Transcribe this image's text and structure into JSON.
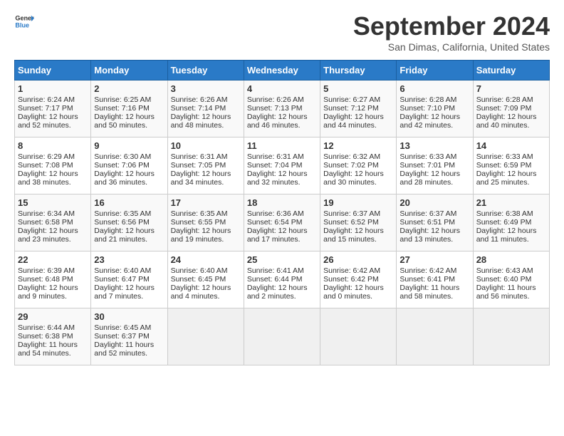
{
  "header": {
    "logo_general": "General",
    "logo_blue": "Blue",
    "title": "September 2024",
    "subtitle": "San Dimas, California, United States"
  },
  "days_of_week": [
    "Sunday",
    "Monday",
    "Tuesday",
    "Wednesday",
    "Thursday",
    "Friday",
    "Saturday"
  ],
  "weeks": [
    [
      {
        "day": "1",
        "sunrise": "6:24 AM",
        "sunset": "7:17 PM",
        "daylight": "12 hours and 52 minutes."
      },
      {
        "day": "2",
        "sunrise": "6:25 AM",
        "sunset": "7:16 PM",
        "daylight": "12 hours and 50 minutes."
      },
      {
        "day": "3",
        "sunrise": "6:26 AM",
        "sunset": "7:14 PM",
        "daylight": "12 hours and 48 minutes."
      },
      {
        "day": "4",
        "sunrise": "6:26 AM",
        "sunset": "7:13 PM",
        "daylight": "12 hours and 46 minutes."
      },
      {
        "day": "5",
        "sunrise": "6:27 AM",
        "sunset": "7:12 PM",
        "daylight": "12 hours and 44 minutes."
      },
      {
        "day": "6",
        "sunrise": "6:28 AM",
        "sunset": "7:10 PM",
        "daylight": "12 hours and 42 minutes."
      },
      {
        "day": "7",
        "sunrise": "6:28 AM",
        "sunset": "7:09 PM",
        "daylight": "12 hours and 40 minutes."
      }
    ],
    [
      {
        "day": "8",
        "sunrise": "6:29 AM",
        "sunset": "7:08 PM",
        "daylight": "12 hours and 38 minutes."
      },
      {
        "day": "9",
        "sunrise": "6:30 AM",
        "sunset": "7:06 PM",
        "daylight": "12 hours and 36 minutes."
      },
      {
        "day": "10",
        "sunrise": "6:31 AM",
        "sunset": "7:05 PM",
        "daylight": "12 hours and 34 minutes."
      },
      {
        "day": "11",
        "sunrise": "6:31 AM",
        "sunset": "7:04 PM",
        "daylight": "12 hours and 32 minutes."
      },
      {
        "day": "12",
        "sunrise": "6:32 AM",
        "sunset": "7:02 PM",
        "daylight": "12 hours and 30 minutes."
      },
      {
        "day": "13",
        "sunrise": "6:33 AM",
        "sunset": "7:01 PM",
        "daylight": "12 hours and 28 minutes."
      },
      {
        "day": "14",
        "sunrise": "6:33 AM",
        "sunset": "6:59 PM",
        "daylight": "12 hours and 25 minutes."
      }
    ],
    [
      {
        "day": "15",
        "sunrise": "6:34 AM",
        "sunset": "6:58 PM",
        "daylight": "12 hours and 23 minutes."
      },
      {
        "day": "16",
        "sunrise": "6:35 AM",
        "sunset": "6:56 PM",
        "daylight": "12 hours and 21 minutes."
      },
      {
        "day": "17",
        "sunrise": "6:35 AM",
        "sunset": "6:55 PM",
        "daylight": "12 hours and 19 minutes."
      },
      {
        "day": "18",
        "sunrise": "6:36 AM",
        "sunset": "6:54 PM",
        "daylight": "12 hours and 17 minutes."
      },
      {
        "day": "19",
        "sunrise": "6:37 AM",
        "sunset": "6:52 PM",
        "daylight": "12 hours and 15 minutes."
      },
      {
        "day": "20",
        "sunrise": "6:37 AM",
        "sunset": "6:51 PM",
        "daylight": "12 hours and 13 minutes."
      },
      {
        "day": "21",
        "sunrise": "6:38 AM",
        "sunset": "6:49 PM",
        "daylight": "12 hours and 11 minutes."
      }
    ],
    [
      {
        "day": "22",
        "sunrise": "6:39 AM",
        "sunset": "6:48 PM",
        "daylight": "12 hours and 9 minutes."
      },
      {
        "day": "23",
        "sunrise": "6:40 AM",
        "sunset": "6:47 PM",
        "daylight": "12 hours and 7 minutes."
      },
      {
        "day": "24",
        "sunrise": "6:40 AM",
        "sunset": "6:45 PM",
        "daylight": "12 hours and 4 minutes."
      },
      {
        "day": "25",
        "sunrise": "6:41 AM",
        "sunset": "6:44 PM",
        "daylight": "12 hours and 2 minutes."
      },
      {
        "day": "26",
        "sunrise": "6:42 AM",
        "sunset": "6:42 PM",
        "daylight": "12 hours and 0 minutes."
      },
      {
        "day": "27",
        "sunrise": "6:42 AM",
        "sunset": "6:41 PM",
        "daylight": "11 hours and 58 minutes."
      },
      {
        "day": "28",
        "sunrise": "6:43 AM",
        "sunset": "6:40 PM",
        "daylight": "11 hours and 56 minutes."
      }
    ],
    [
      {
        "day": "29",
        "sunrise": "6:44 AM",
        "sunset": "6:38 PM",
        "daylight": "11 hours and 54 minutes."
      },
      {
        "day": "30",
        "sunrise": "6:45 AM",
        "sunset": "6:37 PM",
        "daylight": "11 hours and 52 minutes."
      },
      null,
      null,
      null,
      null,
      null
    ]
  ]
}
